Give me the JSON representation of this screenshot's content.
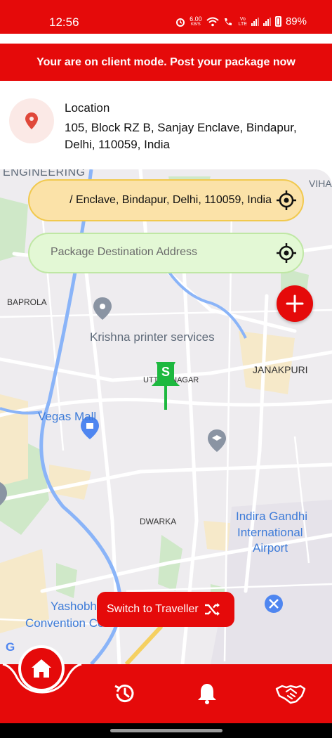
{
  "status_bar": {
    "time": "12:56",
    "net_speed_value": "6.00",
    "net_speed_unit": "KB/S",
    "battery": "89%"
  },
  "banner": {
    "text": "Your are on client mode. Post your package now"
  },
  "location": {
    "title": "Location",
    "address": "105, Block RZ B, Sanjay Enclave, Bindapur, Delhi, 110059, India"
  },
  "pickup": {
    "value": "105, Block RZ B, Sanjay Enclave, Bindapur, Delhi, 110059, India",
    "visible_text": "/ Enclave, Bindapur, Delhi, 110059, India"
  },
  "destination": {
    "placeholder": "Package Destination Address",
    "value": ""
  },
  "map": {
    "labels": {
      "engineering": "ENGINEERING",
      "baprola": "BAPROLA",
      "krishna": "Krishna printer services",
      "uttam_nagar": "UTTAM NAGAR",
      "janakpuri": "JANAKPURI",
      "vegas": "Vegas Mall",
      "dwarka": "DWARKA",
      "igia_1": "Indira Gandhi",
      "igia_2": "International",
      "igia_3": "Airport",
      "yashobhoomi_1": "Yashobh",
      "yashobhoomi_2": "Convention Cente",
      "vihar": "VIHA",
      "pin_letter": "S",
      "google_g": "G"
    }
  },
  "switch_button": {
    "label": "Switch to Traveller"
  },
  "colors": {
    "brand_red": "#e50a0a",
    "pickup_bg": "#fbe2a8",
    "destination_bg": "#e3f8d5",
    "pin_green": "#1db83f"
  },
  "icons": {
    "home": "home-icon",
    "history": "history-icon",
    "notifications": "bell-icon",
    "deals": "handshake-icon"
  }
}
